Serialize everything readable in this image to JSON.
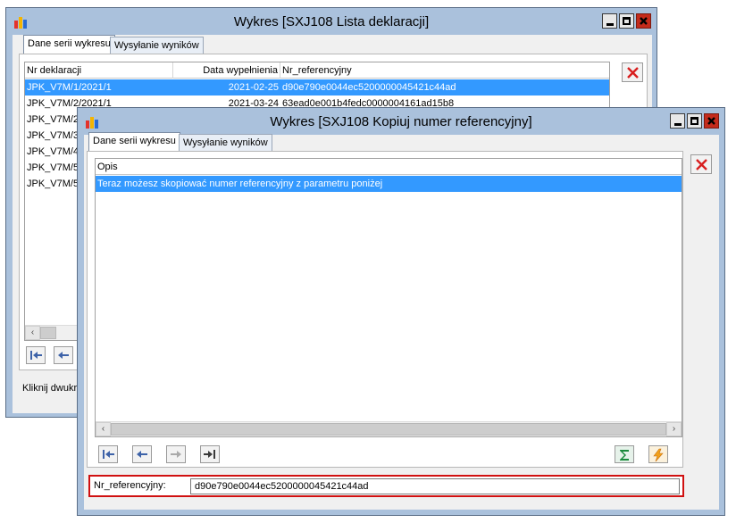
{
  "back_window": {
    "title": "Wykres [SXJ108 Lista deklaracji]",
    "tabs": [
      {
        "label": "Dane serii wykresu",
        "active": true
      },
      {
        "label": "Wysyłanie wyników",
        "active": false
      }
    ],
    "table": {
      "columns": [
        "Nr deklaracji",
        "Data wypełnienia",
        "Nr_referencyjny"
      ],
      "rows": [
        [
          "JPK_V7M/1/2021/1",
          "2021-02-25",
          "d90e790e0044ec5200000045421c44ad"
        ],
        [
          "JPK_V7M/2/2021/1",
          "2021-03-24",
          "63ead0e001b4fedc0000004161ad15b8"
        ],
        [
          "JPK_V7M/2",
          "",
          ""
        ],
        [
          "JPK_V7M/3",
          "",
          ""
        ],
        [
          "JPK_V7M/4",
          "",
          ""
        ],
        [
          "JPK_V7M/5",
          "",
          ""
        ],
        [
          "JPK_V7M/5",
          "",
          ""
        ]
      ],
      "selected_row": 0
    },
    "footer_text": "Kliknij dwukr"
  },
  "front_window": {
    "title": "Wykres [SXJ108 Kopiuj numer referencyjny]",
    "tabs": [
      {
        "label": "Dane serii wykresu",
        "active": true
      },
      {
        "label": "Wysyłanie wyników",
        "active": false
      }
    ],
    "table": {
      "columns": [
        "Opis"
      ],
      "rows": [
        [
          "Teraz możesz skopiować numer referencyjny z parametru poniżej"
        ]
      ],
      "selected_row": 0
    },
    "param": {
      "label": "Nr_referencyjny:",
      "value": "d90e790e0044ec5200000045421c44ad"
    }
  },
  "icons": {
    "window_buttons": [
      "minimize-icon",
      "maximize-icon",
      "close-icon"
    ],
    "nav": [
      "first-icon",
      "prev-icon",
      "next-icon",
      "last-icon"
    ],
    "actions": [
      "sum-icon",
      "lightning-icon",
      "delete-icon"
    ]
  },
  "colors": {
    "window_frame": "#aac1dc",
    "selection": "#3399ff",
    "close_button": "#c42b1c",
    "highlight_border": "#d01010"
  }
}
